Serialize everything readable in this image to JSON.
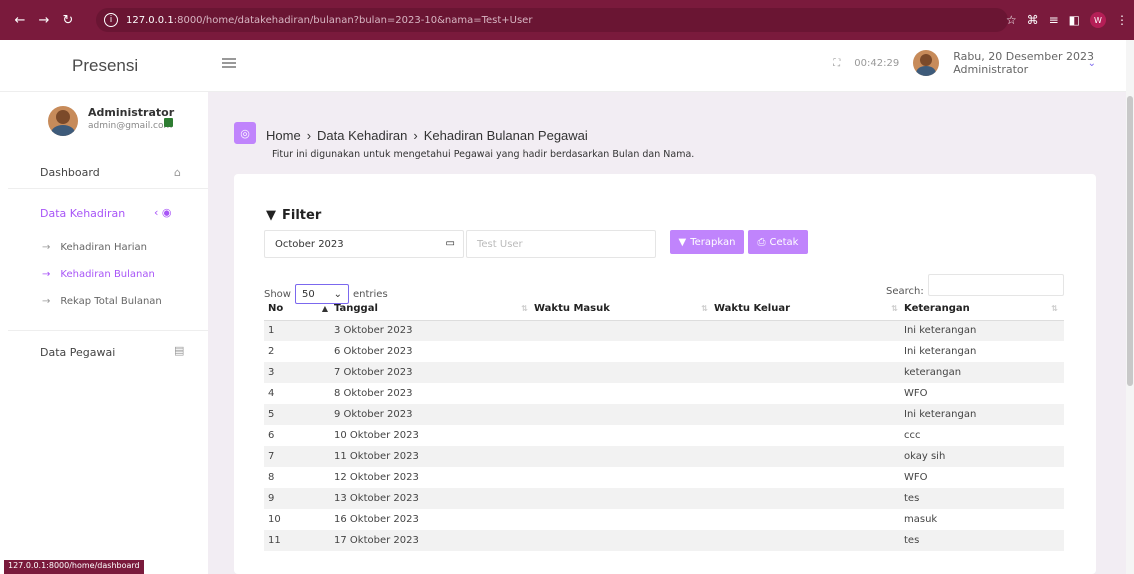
{
  "browser": {
    "url_host": "127.0.0.1",
    "url_path": ":8000/home/datakehadiran/bulanan?bulan=2023-10&nama=Test+User",
    "ext_badge": "W",
    "status_url": "127.0.0.1:8000/home/dashboard"
  },
  "header": {
    "brand": "Presensi",
    "clock": "00:42:29",
    "date": "Rabu, 20 Desember 2023",
    "role": "Administrator"
  },
  "sidebar": {
    "profile_name": "Administrator",
    "profile_email": "admin@gmail.com",
    "dashboard": "Dashboard",
    "data_kehadiran": "Data Kehadiran",
    "sub_items": [
      "Kehadiran Harian",
      "Kehadiran Bulanan",
      "Rekap Total Bulanan"
    ],
    "data_pegawai": "Data Pegawai"
  },
  "page": {
    "crumb_home": "Home",
    "crumb_data": "Data Kehadiran",
    "crumb_current": "Kehadiran Bulanan Pegawai",
    "subtitle": "Fitur ini digunakan untuk mengetahui Pegawai yang hadir berdasarkan Bulan dan Nama."
  },
  "filter": {
    "title": "Filter",
    "month_value": "October 2023",
    "name_placeholder": "Test User",
    "apply_label": "Terapkan",
    "print_label": "Cetak"
  },
  "datatable": {
    "show_label": "Show",
    "entries_value": "50",
    "entries_label": "entries",
    "search_label": "Search:",
    "columns": [
      "No",
      "Tanggal",
      "Waktu Masuk",
      "Waktu Keluar",
      "Keterangan"
    ],
    "rows": [
      [
        "1",
        "3 Oktober 2023",
        "",
        "",
        "Ini keterangan"
      ],
      [
        "2",
        "6 Oktober 2023",
        "",
        "",
        "Ini keterangan"
      ],
      [
        "3",
        "7 Oktober 2023",
        "",
        "",
        "keterangan"
      ],
      [
        "4",
        "8 Oktober 2023",
        "",
        "",
        "WFO"
      ],
      [
        "5",
        "9 Oktober 2023",
        "",
        "",
        "Ini keterangan"
      ],
      [
        "6",
        "10 Oktober 2023",
        "",
        "",
        "ccc"
      ],
      [
        "7",
        "11 Oktober 2023",
        "",
        "",
        "okay sih"
      ],
      [
        "8",
        "12 Oktober 2023",
        "",
        "",
        "WFO"
      ],
      [
        "9",
        "13 Oktober 2023",
        "",
        "",
        "tes"
      ],
      [
        "10",
        "16 Oktober 2023",
        "",
        "",
        "masuk"
      ],
      [
        "11",
        "17 Oktober 2023",
        "",
        "",
        "tes"
      ]
    ]
  },
  "colors": {
    "browser_bar": "#7a1a3c",
    "accent": "#c084fc",
    "active_nav": "#a855f7",
    "content_bg": "#f2edf3"
  }
}
